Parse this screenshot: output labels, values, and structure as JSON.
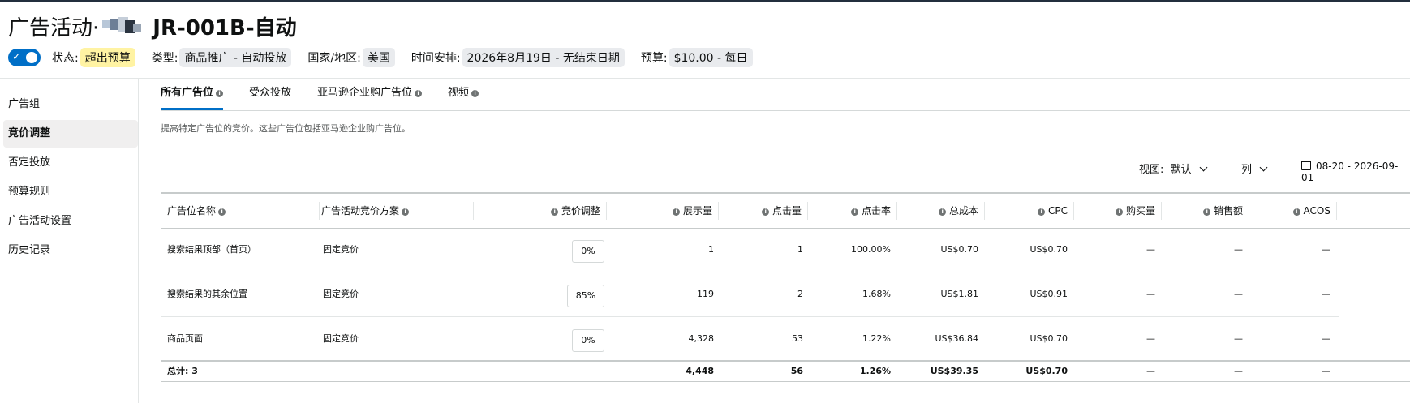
{
  "campaign": {
    "title_prefix": "广告活动·",
    "title_main": "JR-001B-自动"
  },
  "meta": {
    "status_label": "状态:",
    "status_value": "超出预算",
    "type_label": "类型:",
    "type_value": "商品推广 - 自动投放",
    "country_label": "国家/地区:",
    "country_value": "美国",
    "schedule_label": "时间安排:",
    "schedule_value": "2026年8月19日 - 无结束日期",
    "budget_label": "预算:",
    "budget_value": "$10.00 - 每日"
  },
  "sidebar": {
    "items": [
      "广告组",
      "竞价调整",
      "否定投放",
      "预算规则",
      "广告活动设置",
      "历史记录"
    ],
    "active_index": 1
  },
  "tabs": [
    "所有广告位",
    "受众投放",
    "亚马逊企业购广告位",
    "视频"
  ],
  "description": "提高特定广告位的竞价。这些广告位包括亚马逊企业购广告位。",
  "toolbar": {
    "view_label": "视图:",
    "view_value": "默认",
    "columns_label": "列",
    "date_range": "08-20 - 2026-09-01"
  },
  "table": {
    "headers": [
      "广告位名称",
      "广告活动竞价方案",
      "竞价调整",
      "展示量",
      "点击量",
      "点击率",
      "总成本",
      "CPC",
      "购买量",
      "销售额",
      "ACOS"
    ],
    "rows": [
      {
        "name": "搜索结果顶部（首页）",
        "strategy": "固定竞价",
        "bid": "0%",
        "impressions": "1",
        "clicks": "1",
        "ctr": "100.00%",
        "cost": "US$0.70",
        "cpc": "US$0.70",
        "purchases": "—",
        "sales": "—",
        "acos": "—"
      },
      {
        "name": "搜索结果的其余位置",
        "strategy": "固定竞价",
        "bid": "85%",
        "impressions": "119",
        "clicks": "2",
        "ctr": "1.68%",
        "cost": "US$1.81",
        "cpc": "US$0.91",
        "purchases": "—",
        "sales": "—",
        "acos": "—"
      },
      {
        "name": "商品页面",
        "strategy": "固定竞价",
        "bid": "0%",
        "impressions": "4,328",
        "clicks": "53",
        "ctr": "1.22%",
        "cost": "US$36.84",
        "cpc": "US$0.70",
        "purchases": "—",
        "sales": "—",
        "acos": "—"
      }
    ],
    "total": {
      "label": "总计: 3",
      "impressions": "4,448",
      "clicks": "56",
      "ctr": "1.26%",
      "cost": "US$39.35",
      "cpc": "US$0.70",
      "purchases": "—",
      "sales": "—",
      "acos": "—"
    }
  },
  "colors": {
    "toggle_on": "#006fc7",
    "status_highlight": "#fff3a3",
    "chip_bg": "#e9ebee",
    "tab_underline": "#006fc7"
  }
}
